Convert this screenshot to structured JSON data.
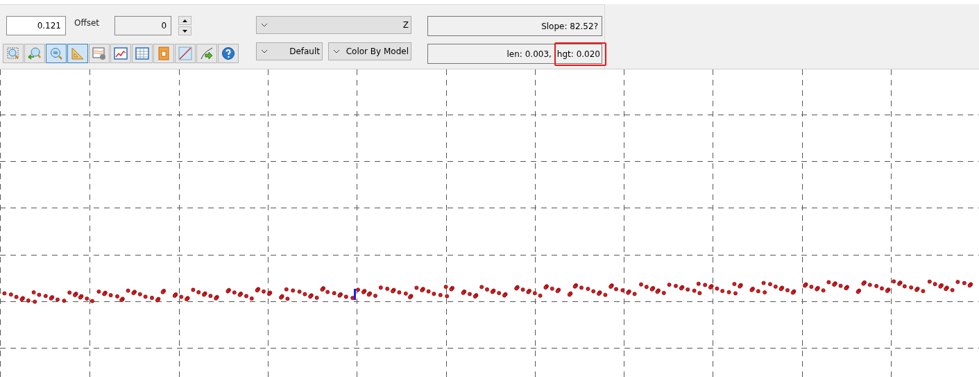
{
  "scale_field": {
    "value": "0.121"
  },
  "offset": {
    "label": "Offset",
    "value": "0"
  },
  "tools": [
    {
      "kind": "zoom-box",
      "selected": false
    },
    {
      "kind": "zoom-back",
      "selected": false
    },
    {
      "kind": "zoom",
      "selected": true
    },
    {
      "kind": "ruler",
      "selected": true
    },
    {
      "kind": "chart-settings",
      "selected": false
    },
    {
      "kind": "line-chart",
      "selected": false
    },
    {
      "kind": "table",
      "selected": false
    },
    {
      "kind": "document",
      "selected": false
    },
    {
      "kind": "diagonal",
      "selected": false
    },
    {
      "kind": "export",
      "selected": false
    },
    {
      "kind": "help",
      "selected": false
    }
  ],
  "axis_dropdown": {
    "value": "Z"
  },
  "style_dropdown": {
    "value": "Default"
  },
  "color_dropdown": {
    "value": "Color By Model"
  },
  "slope": {
    "text": "Slope: 82.52?"
  },
  "measure": {
    "parts": [
      {
        "text": "len: 0.003,",
        "highlighted": false
      },
      {
        "text": "hgt: 0.020",
        "highlighted": true
      }
    ]
  }
}
